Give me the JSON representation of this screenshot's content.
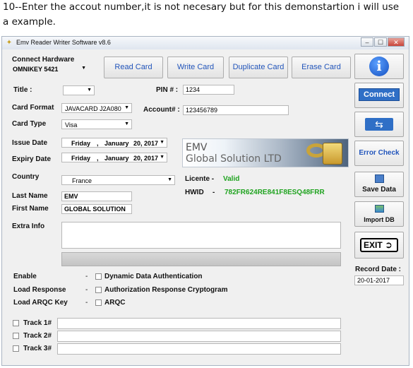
{
  "caption": "10--Enter the accout number,it is not necesary but for this demonstartion i will use a example.",
  "window": {
    "title": "Emv Reader Writer Software v8.6",
    "min_glyph": "–",
    "max_glyph": "☐",
    "close_glyph": "✕"
  },
  "hardware": {
    "label": "Connect Hardware",
    "value": "OMNIKEY 5421"
  },
  "toolbar": {
    "read": "Read Card",
    "write": "Write Card",
    "duplicate": "Duplicate Card",
    "erase": "Erase Card"
  },
  "form": {
    "title_label": "Title :",
    "title_value": "",
    "pin_label": "PIN # :",
    "pin_value": "1234",
    "card_format_label": "Card Format",
    "card_format_value": "JAVACARD J2A080",
    "account_label": "Account# :",
    "account_value": "123456789",
    "card_type_label": "Card Type",
    "card_type_value": "Visa",
    "issue_label": "Issue Date",
    "issue_day": "Friday",
    "issue_sep": ",",
    "issue_month": "January",
    "issue_date": "20, 2017",
    "expiry_label": "Expiry Date",
    "expiry_day": "Friday",
    "expiry_sep": ",",
    "expiry_month": "January",
    "expiry_date": "20, 2017",
    "country_label": "Country",
    "country_value": "France",
    "last_name_label": "Last Name",
    "last_name_value": "EMV",
    "first_name_label": "First Name",
    "first_name_value": "GLOBAL SOLUTION",
    "extra_label": "Extra Info",
    "extra_value": ""
  },
  "banner": {
    "line1": "EMV",
    "line2": "Global Solution LTD"
  },
  "license": {
    "licence_label": "Licente -",
    "licence_value": "Valid",
    "hwid_label": "HWID",
    "hwid_dash": "-",
    "hwid_value": "782FR624RE841F8ESQ48FRR",
    "value_color": "#1fa31f"
  },
  "options": [
    {
      "label": "Enable",
      "dash": "-",
      "text": "Dynamic Data Authentication"
    },
    {
      "label": "Load Response",
      "dash": "-",
      "text": "Authorization Response Cryptogram"
    },
    {
      "label": "Load ARQC Key",
      "dash": "-",
      "text": "ARQC"
    }
  ],
  "tracks": [
    {
      "label": "Track 1#",
      "value": ""
    },
    {
      "label": "Track 2#",
      "value": ""
    },
    {
      "label": "Track 3#",
      "value": ""
    }
  ],
  "sidebar": {
    "info_glyph": "i",
    "connect": "Connect",
    "usb_glyph": "⇆",
    "error_check": "Error Check",
    "save_data": "Save Data",
    "import_db": "Import DB",
    "exit": "EXIT",
    "exit_glyph": "➲",
    "record_date_label": "Record Date :",
    "record_date_value": "20-01-2017"
  },
  "colors": {
    "accent_blue": "#2255bb",
    "connect_blue": "#2f6fc6",
    "green": "#1fa31f"
  }
}
